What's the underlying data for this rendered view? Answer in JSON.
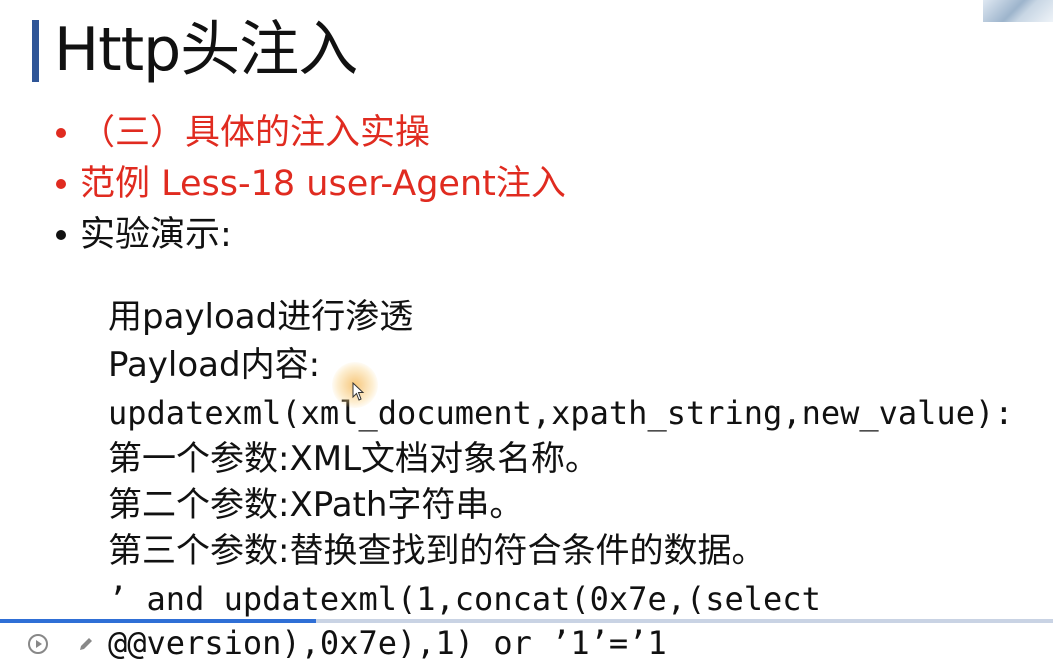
{
  "slide": {
    "title": "Http头注入",
    "bullets": [
      {
        "text": "（三）具体的注入实操",
        "color": "#e02b20"
      },
      {
        "text": "范例 Less-18 user-Agent注入",
        "color": "#e02b20"
      },
      {
        "text": "实验演示:",
        "color": "#111111"
      }
    ],
    "body_lines": [
      "用payload进行渗透",
      "Payload内容:",
      "updatexml(xml_document,xpath_string,new_value):",
      "第一个参数:XML文档对象名称。",
      "第二个参数:XPath字符串。",
      "第三个参数:替换查找到的符合条件的数据。",
      "’ and updatexml(1,concat(0x7e,(select",
      "@@version),0x7e),1) or ’1’=’1"
    ]
  },
  "player": {
    "progress": 0.3,
    "play_icon": "play-icon",
    "edit_icon": "pencil-icon"
  },
  "colors": {
    "accent": "#2f5597",
    "bullet_red": "#e02b20",
    "progress": "#2f6fd6"
  }
}
